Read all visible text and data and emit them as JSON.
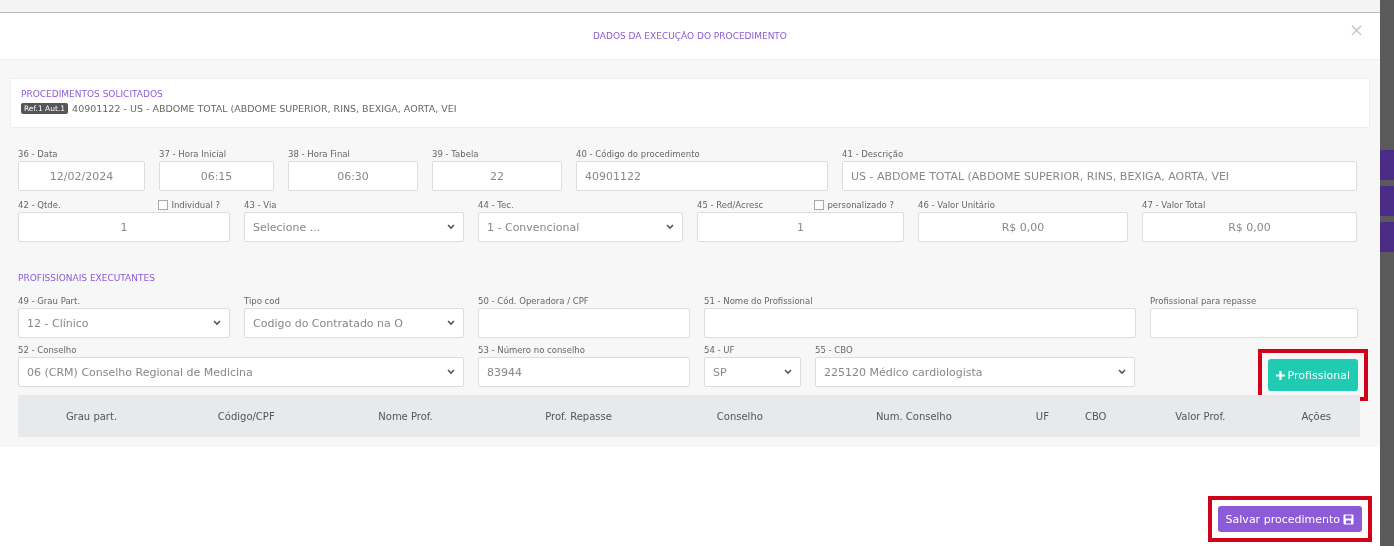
{
  "modal": {
    "title": "DADOS DA EXECUÇÃO DO PROCEDIMENTO",
    "close": "×"
  },
  "requested": {
    "heading": "PROCEDIMENTOS SOLICITADOS",
    "badge": "Ref.1 Aut.1",
    "text": "40901122 - US - ABDOME TOTAL (ABDOME SUPERIOR, RINS, BEXIGA, AORTA, VEI"
  },
  "execution_rows": [
    [
      {
        "label": "36 - Data",
        "value": "12/02/2024",
        "kind": "input"
      },
      {
        "label": "37 - Hora Inicial",
        "value": "06:15",
        "kind": "input"
      },
      {
        "label": "38 - Hora Final",
        "value": "06:30",
        "kind": "input"
      },
      {
        "label": "39 - Tabela",
        "value": "22",
        "kind": "input"
      },
      {
        "label": "40 - Código do procedimento",
        "value": "40901122",
        "kind": "input"
      },
      {
        "label": "41 - Descrição",
        "value": "US - ABDOME TOTAL (ABDOME SUPERIOR, RINS, BEXIGA, AORTA, VEI",
        "kind": "input"
      }
    ],
    [
      {
        "label": "42 - Qtde.",
        "value": "1",
        "kind": "input",
        "checkbox": {
          "label": "Individual ?",
          "checked": false
        }
      },
      {
        "label": "43 - Via",
        "value": "Selecione ...",
        "kind": "select"
      },
      {
        "label": "44 - Tec.",
        "value": "1 - Convencional",
        "kind": "select"
      },
      {
        "label": "45 - Red/Acresc",
        "value": "1",
        "kind": "input",
        "checkbox": {
          "label": "personalizado ?",
          "checked": false
        }
      },
      {
        "label": "46 - Valor Unitário",
        "value": "R$ 0,00",
        "kind": "input"
      },
      {
        "label": "47 - Valor Total",
        "value": "R$ 0,00",
        "kind": "input"
      }
    ]
  ],
  "professionals": {
    "heading": "PROFISSIONAIS EXECUTANTES",
    "fields": [
      {
        "label": "49 - Grau Part.",
        "value": "12 - Clínico",
        "kind": "select"
      },
      {
        "label": "Tipo cod",
        "value": "Codigo do Contratado na O",
        "kind": "select"
      },
      {
        "label": "50 - Cód. Operadora / CPF",
        "kind": "input"
      },
      {
        "label": "51 - Nome do Profissional",
        "kind": "input"
      },
      {
        "label": "Profissional para repasse",
        "kind": "input"
      },
      {
        "label": "52 - Conselho",
        "value": "06 (CRM) Conselho Regional de Medicina",
        "kind": "select"
      },
      {
        "label": "53 - Número no conselho",
        "value": "83944",
        "kind": "input"
      },
      {
        "label": "54 - UF",
        "value": "SP",
        "kind": "select"
      },
      {
        "label": "55 - CBO",
        "value": "225120 Médico cardiologista",
        "kind": "select"
      }
    ],
    "add_button": {
      "label": "Profissional",
      "highlighted": true
    },
    "table": {
      "columns": [
        "Grau part.",
        "Código/CPF",
        "Nome Prof.",
        "Prof. Repasse",
        "Conselho",
        "Num. Conselho",
        "UF",
        "CBO",
        "Valor Prof.",
        "Ações"
      ]
    }
  },
  "save_button": {
    "label": "Salvar procedimento",
    "highlighted": true
  }
}
